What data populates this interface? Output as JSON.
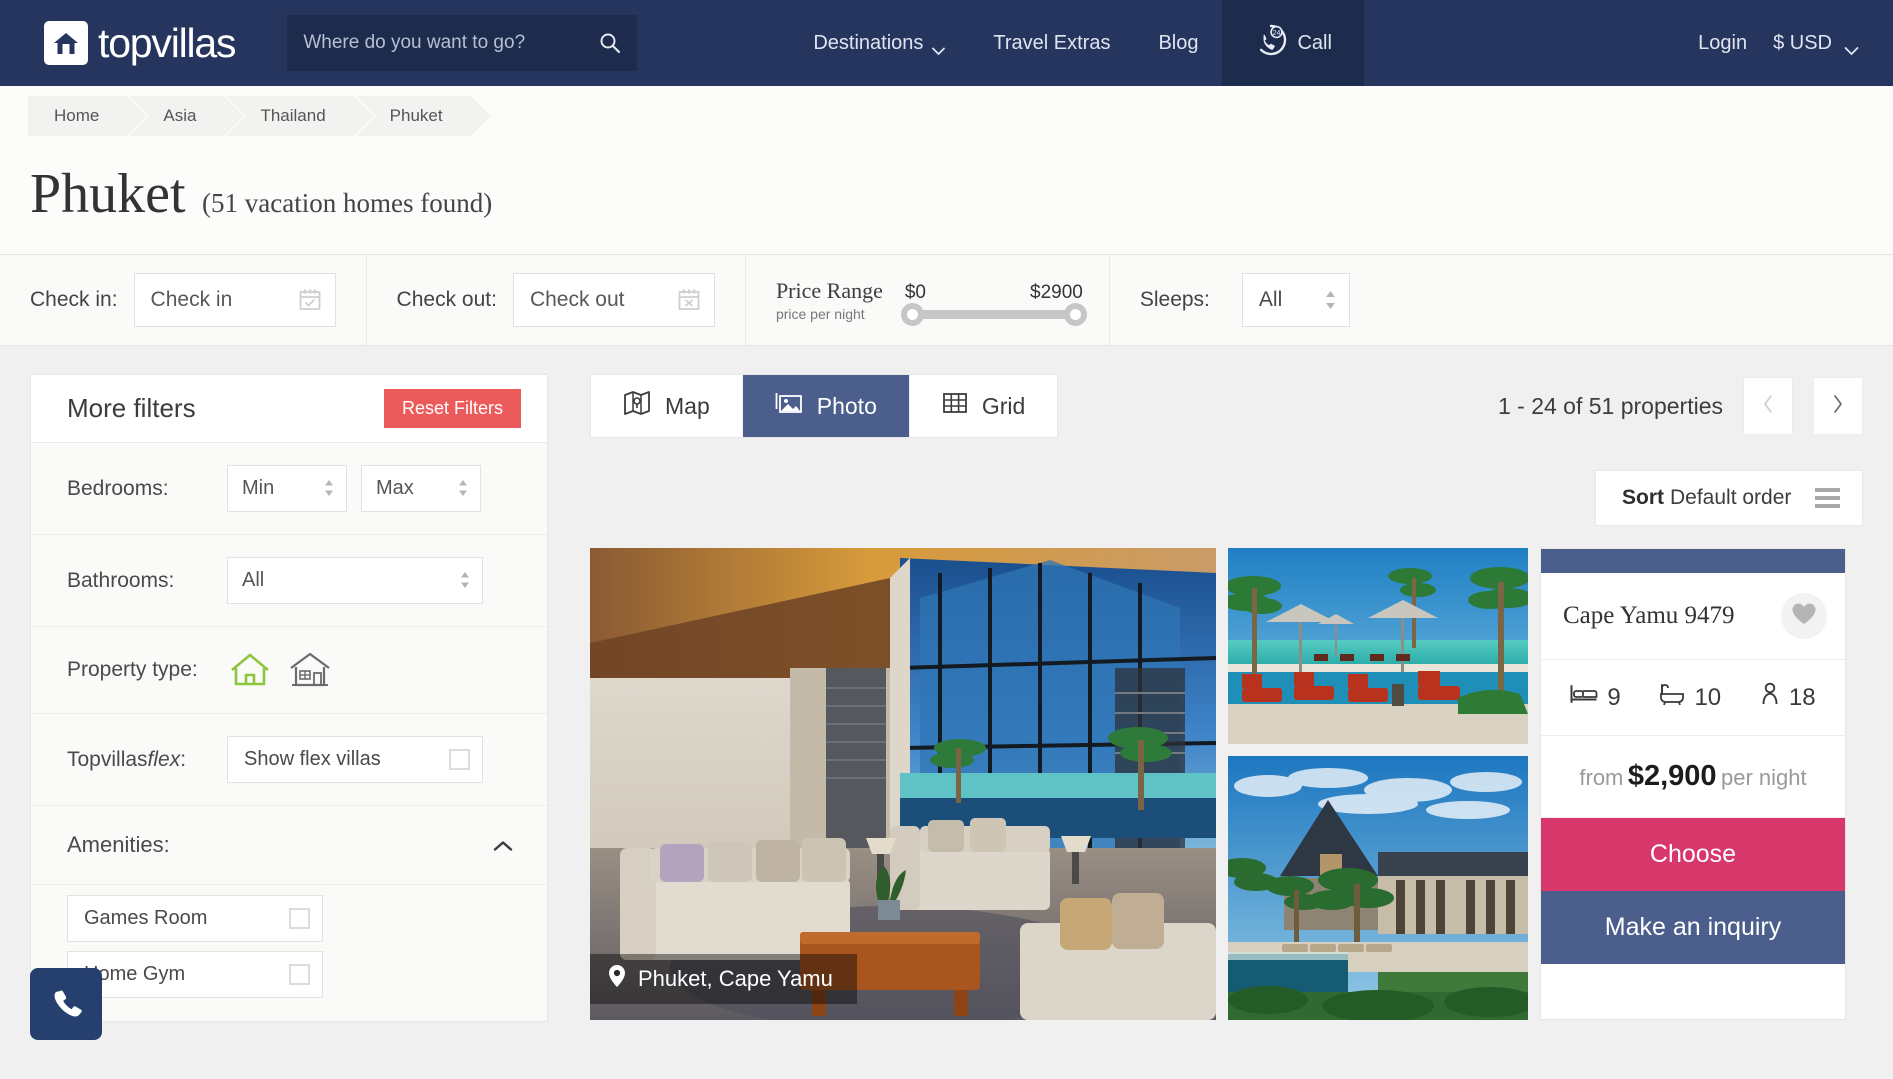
{
  "header": {
    "brand": "topvillas",
    "logo_icon": "house-icon",
    "search": {
      "placeholder": "Where do you want to go?",
      "value": "",
      "icon": "search-icon"
    },
    "nav": [
      {
        "label": "Destinations",
        "icon": "chevron-down-icon",
        "boxed": false
      },
      {
        "label": "Travel Extras",
        "icon": "",
        "boxed": false
      },
      {
        "label": "Blog",
        "icon": "",
        "boxed": false
      },
      {
        "label": "Call",
        "icon": "phone-24-icon",
        "boxed": true
      }
    ],
    "login_label": "Login",
    "currency_label": "$ USD",
    "currency_icon": "chevron-down-icon"
  },
  "breadcrumb": [
    {
      "label": "Home"
    },
    {
      "label": "Asia"
    },
    {
      "label": "Thailand"
    },
    {
      "label": "Phuket"
    }
  ],
  "page": {
    "title": "Phuket",
    "subtitle": "(51 vacation homes found)"
  },
  "filterbar": {
    "checkin": {
      "label": "Check in:",
      "placeholder": "Check in",
      "value": "",
      "icon": "calendar-check-icon"
    },
    "checkout": {
      "label": "Check out:",
      "placeholder": "Check out",
      "value": "",
      "icon": "calendar-x-icon"
    },
    "price": {
      "label": "Price Range",
      "sublabel": "price per night",
      "min_label": "$0",
      "max_label": "$2900",
      "min": 0,
      "max": 2900
    },
    "sleeps": {
      "label": "Sleeps:",
      "value": "All",
      "icon": "spinner-icon"
    }
  },
  "sidebar": {
    "title": "More filters",
    "reset_label": "Reset Filters",
    "bedrooms": {
      "label": "Bedrooms:",
      "min_value": "Min",
      "max_value": "Max"
    },
    "bathrooms": {
      "label": "Bathrooms:",
      "value": "All"
    },
    "property_type": {
      "label": "Property type:",
      "options": [
        {
          "icon": "home-outline-icon",
          "color": "#8cc63f",
          "name": "villa"
        },
        {
          "icon": "house-detailed-icon",
          "color": "#6b6b6b",
          "name": "condo"
        }
      ]
    },
    "flex": {
      "label": "Topvillasflex:",
      "label_plain": "Topvillas",
      "label_italic": "flex",
      "option": "Show flex villas",
      "checked": false
    },
    "amenities": {
      "label": "Amenities:",
      "icon": "caret-up-icon",
      "expanded": true,
      "items": [
        {
          "label": "Games Room",
          "checked": false
        },
        {
          "label": "Home Gym",
          "checked": false
        }
      ]
    },
    "call_fab_icon": "phone-icon"
  },
  "main": {
    "view_tabs": [
      {
        "label": "Map",
        "icon": "map-icon",
        "active": false
      },
      {
        "label": "Photo",
        "icon": "photo-icon",
        "active": true
      },
      {
        "label": "Grid",
        "icon": "grid-icon",
        "active": false
      }
    ],
    "results_text": "1 - 24 of 51 properties",
    "prev_icon": "chevron-left-icon",
    "next_icon": "chevron-right-icon",
    "sort": {
      "label": "Sort",
      "value": "Default order",
      "icon": "list-icon"
    },
    "property": {
      "location": "Phuket, Cape Yamu",
      "location_icon": "map-pin-icon",
      "name": "Cape Yamu 9479",
      "favorite_icon": "heart-icon",
      "stats": [
        {
          "icon": "bed-icon",
          "value": "9"
        },
        {
          "icon": "bath-icon",
          "value": "10"
        },
        {
          "icon": "person-icon",
          "value": "18"
        }
      ],
      "price_from": "from",
      "price": "$2,900",
      "price_per": "per night",
      "choose_label": "Choose",
      "inquiry_label": "Make an inquiry"
    }
  },
  "colors": {
    "header_bg": "#25355e",
    "header_box": "#1d2b4d",
    "accent_blue": "#4c5f8c",
    "accent_pink": "#d8376b",
    "reset_red": "#ec5b5b",
    "page_bg": "#f0f0f0",
    "panel_bg": "#fafaf8",
    "green_icon": "#8cc63f"
  }
}
